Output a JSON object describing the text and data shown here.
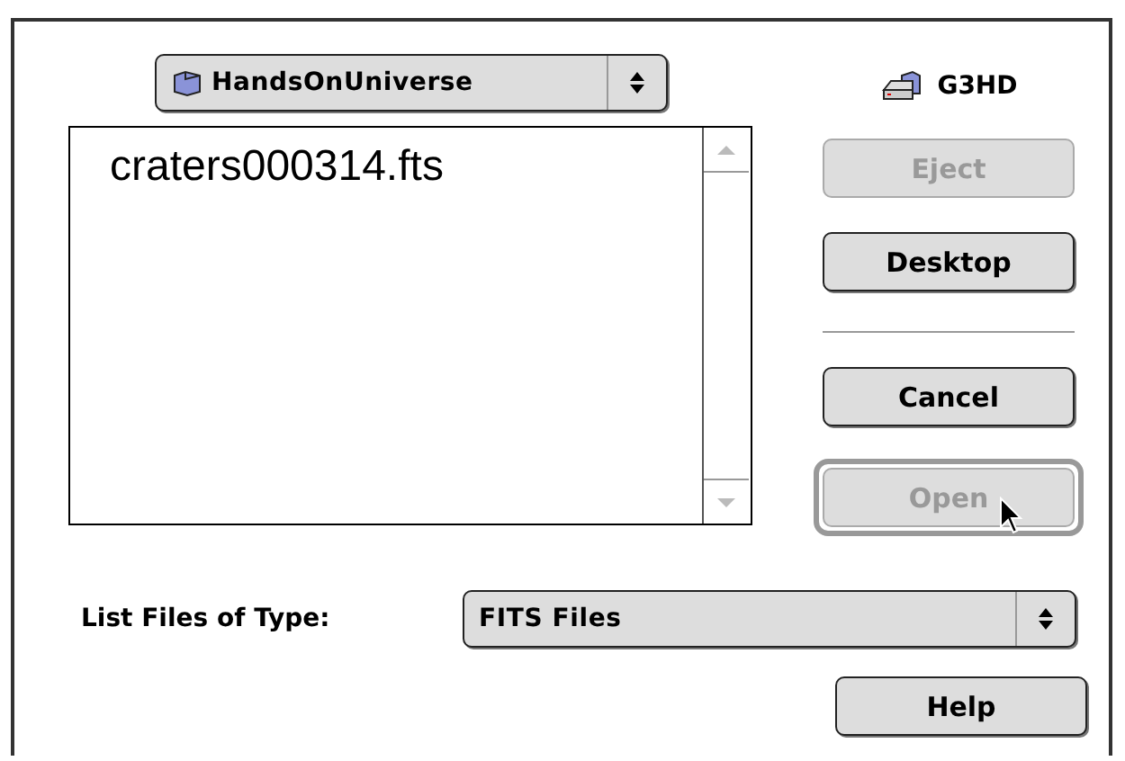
{
  "folder_popup": {
    "value": "HandsOnUniverse"
  },
  "disk": {
    "name": "G3HD"
  },
  "files": [
    {
      "name": "craters000314.fts",
      "selected": false
    }
  ],
  "buttons": [
    {
      "label": "Eject",
      "disabled": true,
      "default": false
    },
    {
      "label": "Desktop",
      "disabled": false,
      "default": false
    },
    {
      "kind": "separator"
    },
    {
      "label": "Cancel",
      "disabled": false,
      "default": false
    },
    {
      "label": "Open",
      "disabled": true,
      "default": true
    }
  ],
  "type_row": {
    "label": "List Files of Type:",
    "value": "FITS Files"
  },
  "help_button": {
    "label": "Help",
    "disabled": false
  }
}
